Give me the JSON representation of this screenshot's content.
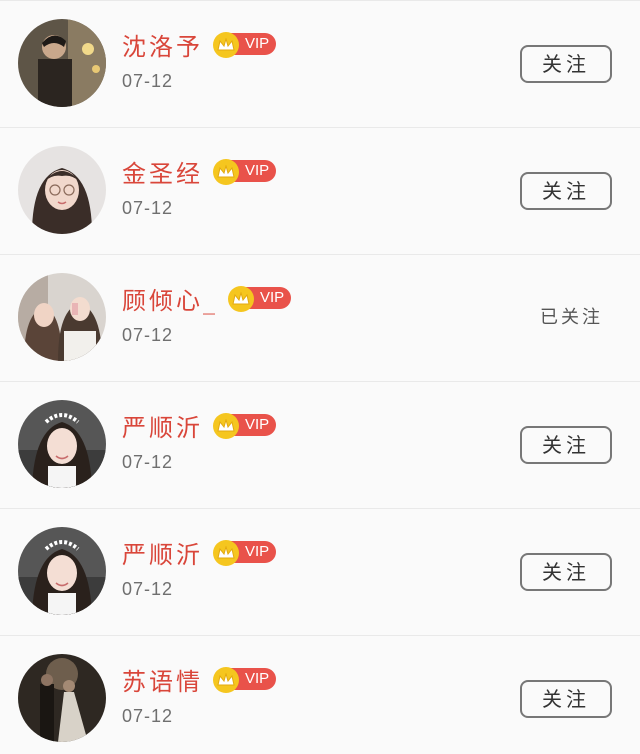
{
  "users": [
    {
      "name": "沈洛予",
      "vip_label": "VIP",
      "date": "07-12",
      "follow_label": "关注",
      "followed": false,
      "avatar_icon": "avatar-man-dark"
    },
    {
      "name": "金圣经",
      "vip_label": "VIP",
      "date": "07-12",
      "follow_label": "关注",
      "followed": false,
      "avatar_icon": "avatar-girl-glasses"
    },
    {
      "name": "顾倾心_",
      "vip_label": "VIP",
      "date": "07-12",
      "follow_label": "已关注",
      "followed": true,
      "avatar_icon": "avatar-couple"
    },
    {
      "name": "严顺沂",
      "vip_label": "VIP",
      "date": "07-12",
      "follow_label": "关注",
      "followed": false,
      "avatar_icon": "avatar-girl-flower-crown"
    },
    {
      "name": "严顺沂",
      "vip_label": "VIP",
      "date": "07-12",
      "follow_label": "关注",
      "followed": false,
      "avatar_icon": "avatar-girl-flower-crown"
    },
    {
      "name": "苏语情",
      "vip_label": "VIP",
      "date": "07-12",
      "follow_label": "关注",
      "followed": false,
      "avatar_icon": "avatar-wedding-couple"
    }
  ],
  "colors": {
    "name": "#d9463a",
    "vip_pill": "#e9524a",
    "crown": "#f5c61f"
  }
}
